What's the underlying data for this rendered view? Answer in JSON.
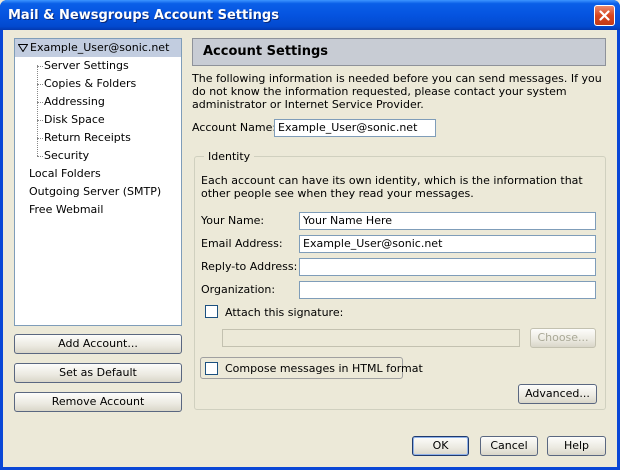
{
  "window": {
    "title": "Mail & Newsgroups Account Settings"
  },
  "tree": {
    "account": "Example_User@sonic.net",
    "children": [
      "Server Settings",
      "Copies & Folders",
      "Addressing",
      "Disk Space",
      "Return Receipts",
      "Security"
    ],
    "others": [
      "Local Folders",
      "Outgoing Server (SMTP)",
      "Free Webmail"
    ]
  },
  "left_buttons": {
    "add": "Add Account...",
    "default": "Set as Default",
    "remove": "Remove Account"
  },
  "panel": {
    "title": "Account Settings",
    "intro": "The following information is needed before you can send messages. If you do not know the information requested, please contact your system administrator or Internet Service Provider.",
    "account_name_label": "Account Name:",
    "account_name_value": "Example_User@sonic.net"
  },
  "identity": {
    "title": "Identity",
    "desc": "Each account can have its own identity, which is the information that other people see when they read your messages.",
    "your_name_label": "Your Name:",
    "your_name_value": "Your Name Here",
    "email_label": "Email Address:",
    "email_value": "Example_User@sonic.net",
    "reply_label": "Reply-to Address:",
    "reply_value": "",
    "org_label": "Organization:",
    "org_value": "",
    "signature_label": "Attach this signature:",
    "signature_path": "",
    "choose_label": "Choose...",
    "html_label": "Compose messages in HTML format",
    "advanced_label": "Advanced..."
  },
  "footer": {
    "ok": "OK",
    "cancel": "Cancel",
    "help": "Help"
  }
}
